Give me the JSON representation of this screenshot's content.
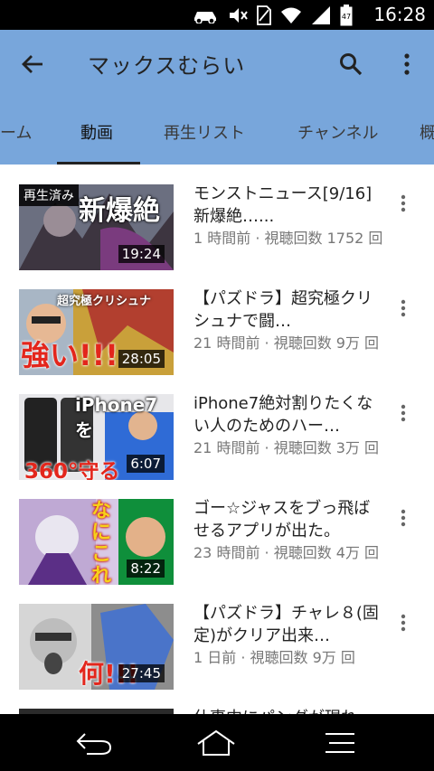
{
  "status_bar": {
    "time": "16:28",
    "battery_level": "47",
    "icons": [
      "car-mode-icon",
      "mute-icon",
      "sim-icon",
      "wifi-icon",
      "signal-icon",
      "battery-icon"
    ]
  },
  "app_bar": {
    "title": "マックスむらい",
    "back_icon": "arrow-left-icon",
    "search_icon": "search-icon",
    "menu_icon": "more-vertical-icon"
  },
  "tabs": [
    {
      "label": "ーム"
    },
    {
      "label": "動画",
      "active": true
    },
    {
      "label": "再生リスト"
    },
    {
      "label": "チャンネル"
    },
    {
      "label": "概"
    }
  ],
  "videos": [
    {
      "title": "モンストニュース[9/16]新爆絶…...",
      "meta": "1 時間前 · 視聴回数 1752 回",
      "duration": "19:24",
      "watched_label": "再生済み",
      "thumb_text": "新爆絶"
    },
    {
      "title": "【パズドラ】超究極クリシュナで闘…",
      "meta": "21 時間前 · 視聴回数 9万 回",
      "duration": "28:05",
      "thumb_text": "超究極クリシュナ",
      "thumb_text2": "強い!!!"
    },
    {
      "title": "iPhone7絶対割りたくない人のためのハー…",
      "meta": "21 時間前 · 視聴回数 3万 回",
      "duration": "6:07",
      "thumb_text": "iPhone7を",
      "thumb_text2": "360°守る"
    },
    {
      "title": "ゴー☆ジャスをブっ飛ばせるアプリが出た。",
      "meta": "23 時間前 · 視聴回数 4万 回",
      "duration": "8:22",
      "thumb_text": "なにこれ"
    },
    {
      "title": "【パズドラ】チャレ８(固定)がクリア出来…",
      "meta": "1 日前 · 視聴回数 9万 回",
      "duration": "27:45",
      "thumb_text": "何!!!"
    },
    {
      "title": "仕事中にパンダが現れ…",
      "meta": "",
      "duration": ""
    }
  ],
  "nav_bar": {
    "icons": [
      "back-nav-icon",
      "home-nav-icon",
      "recents-nav-icon"
    ]
  },
  "colors": {
    "app_bar": "#78a6db",
    "status_bar": "#000000",
    "nav_bar": "#000000"
  }
}
